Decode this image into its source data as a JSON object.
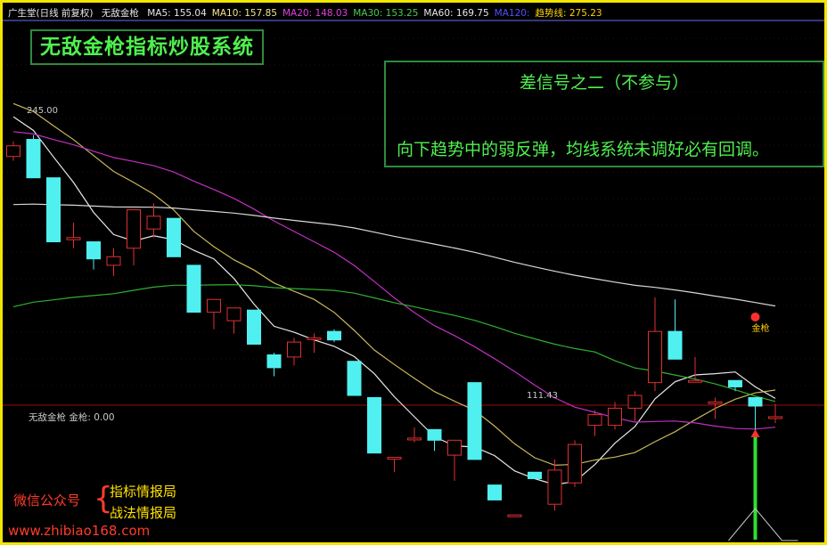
{
  "header": {
    "stock": "广生堂(日线 前复权)",
    "indicator": "无敌金枪",
    "ma_items": [
      {
        "text": "MA5: 155.04",
        "color": "#e8e8e8"
      },
      {
        "text": "MA10: 157.85",
        "color": "#f0e68c"
      },
      {
        "text": "MA20: 148.03",
        "color": "#e040e0"
      },
      {
        "text": "MA30: 153.25",
        "color": "#4ccc4c"
      },
      {
        "text": "MA60: 169.75",
        "color": "#e8e8e8"
      },
      {
        "text": "MA120:",
        "color": "#5050ff"
      },
      {
        "text": "趋势线: 275.23",
        "color": "#ffd400"
      }
    ]
  },
  "title_box": "无敌金枪指标炒股系统",
  "note": {
    "title": "差信号之二（不参与）",
    "body": "向下趋势中的弱反弹，均线系统未调好必有回调。"
  },
  "sub_panel": {
    "label": "无敌金枪  金枪: 0.00"
  },
  "watermark": {
    "wechat_label": "微信公众号",
    "brace": "{",
    "line1": "指标情报局",
    "line2": "战法情报局",
    "website": "www.zhibiao168.com"
  },
  "colors": {
    "up": "#e03030",
    "down": "#50f0f0",
    "ma5": "#e8e8e8",
    "ma10": "#c8b85a",
    "ma20": "#c030c0",
    "ma30": "#30b030",
    "ma60": "#d8d8d8",
    "signal": "#30e030",
    "frame": "#f2e600"
  },
  "chart_data": {
    "type": "candlestick",
    "annotations": {
      "high": "245.00",
      "low": "111.43",
      "signal": "金枪"
    },
    "candles": [
      {
        "o": 223,
        "h": 230,
        "l": 221,
        "c": 228
      },
      {
        "o": 231,
        "h": 233,
        "l": 213,
        "c": 213
      },
      {
        "o": 213,
        "h": 213,
        "l": 183,
        "c": 183
      },
      {
        "o": 184,
        "h": 192,
        "l": 180,
        "c": 185
      },
      {
        "o": 183,
        "h": 183,
        "l": 170,
        "c": 175
      },
      {
        "o": 172,
        "h": 180,
        "l": 167,
        "c": 176
      },
      {
        "o": 180,
        "h": 198,
        "l": 172,
        "c": 198
      },
      {
        "o": 189,
        "h": 201,
        "l": 185,
        "c": 195
      },
      {
        "o": 194,
        "h": 194,
        "l": 176,
        "c": 176
      },
      {
        "o": 172,
        "h": 172,
        "l": 150,
        "c": 150
      },
      {
        "o": 150,
        "h": 155,
        "l": 142,
        "c": 156
      },
      {
        "o": 146,
        "h": 152,
        "l": 140,
        "c": 152
      },
      {
        "o": 151,
        "h": 151,
        "l": 135,
        "c": 135
      },
      {
        "o": 130,
        "h": 131,
        "l": 120,
        "c": 124
      },
      {
        "o": 129,
        "h": 138,
        "l": 125,
        "c": 136
      },
      {
        "o": 138,
        "h": 140,
        "l": 131,
        "c": 138
      },
      {
        "o": 141,
        "h": 142,
        "l": 136,
        "c": 137
      },
      {
        "o": 127,
        "h": 127,
        "l": 117,
        "c": 111
      },
      {
        "o": 110,
        "h": 110,
        "l": 84,
        "c": 84
      },
      {
        "o": 82,
        "h": 82,
        "l": 75,
        "c": 82
      },
      {
        "o": 91,
        "h": 96,
        "l": 89,
        "c": 91
      },
      {
        "o": 95,
        "h": 95,
        "l": 85,
        "c": 90
      },
      {
        "o": 83,
        "h": 90,
        "l": 71,
        "c": 90
      },
      {
        "o": 117,
        "h": 117,
        "l": 81,
        "c": 81
      },
      {
        "o": 69,
        "h": 69,
        "l": 62,
        "c": 62
      },
      {
        "o": 55,
        "h": 55,
        "l": 55,
        "c": 55
      },
      {
        "o": 75,
        "h": 75,
        "l": 72,
        "c": 72
      },
      {
        "o": 60,
        "h": 81,
        "l": 57,
        "c": 76
      },
      {
        "o": 70,
        "h": 90,
        "l": 68,
        "c": 88
      },
      {
        "o": 97,
        "h": 104,
        "l": 92,
        "c": 102
      },
      {
        "o": 97,
        "h": 108,
        "l": 95,
        "c": 105
      },
      {
        "o": 105,
        "h": 113,
        "l": 99,
        "c": 111
      },
      {
        "o": 117,
        "h": 157,
        "l": 113,
        "c": 141
      },
      {
        "o": 141,
        "h": 156,
        "l": 129,
        "c": 128
      },
      {
        "o": 118,
        "h": 129,
        "l": 118,
        "c": 118
      },
      {
        "o": 108,
        "h": 110,
        "l": 100,
        "c": 108
      },
      {
        "o": 118,
        "h": 118,
        "l": 113,
        "c": 115
      },
      {
        "o": 110,
        "h": 110,
        "l": 92,
        "c": 106
      },
      {
        "o": 101,
        "h": 107,
        "l": 98,
        "c": 101
      }
    ]
  }
}
